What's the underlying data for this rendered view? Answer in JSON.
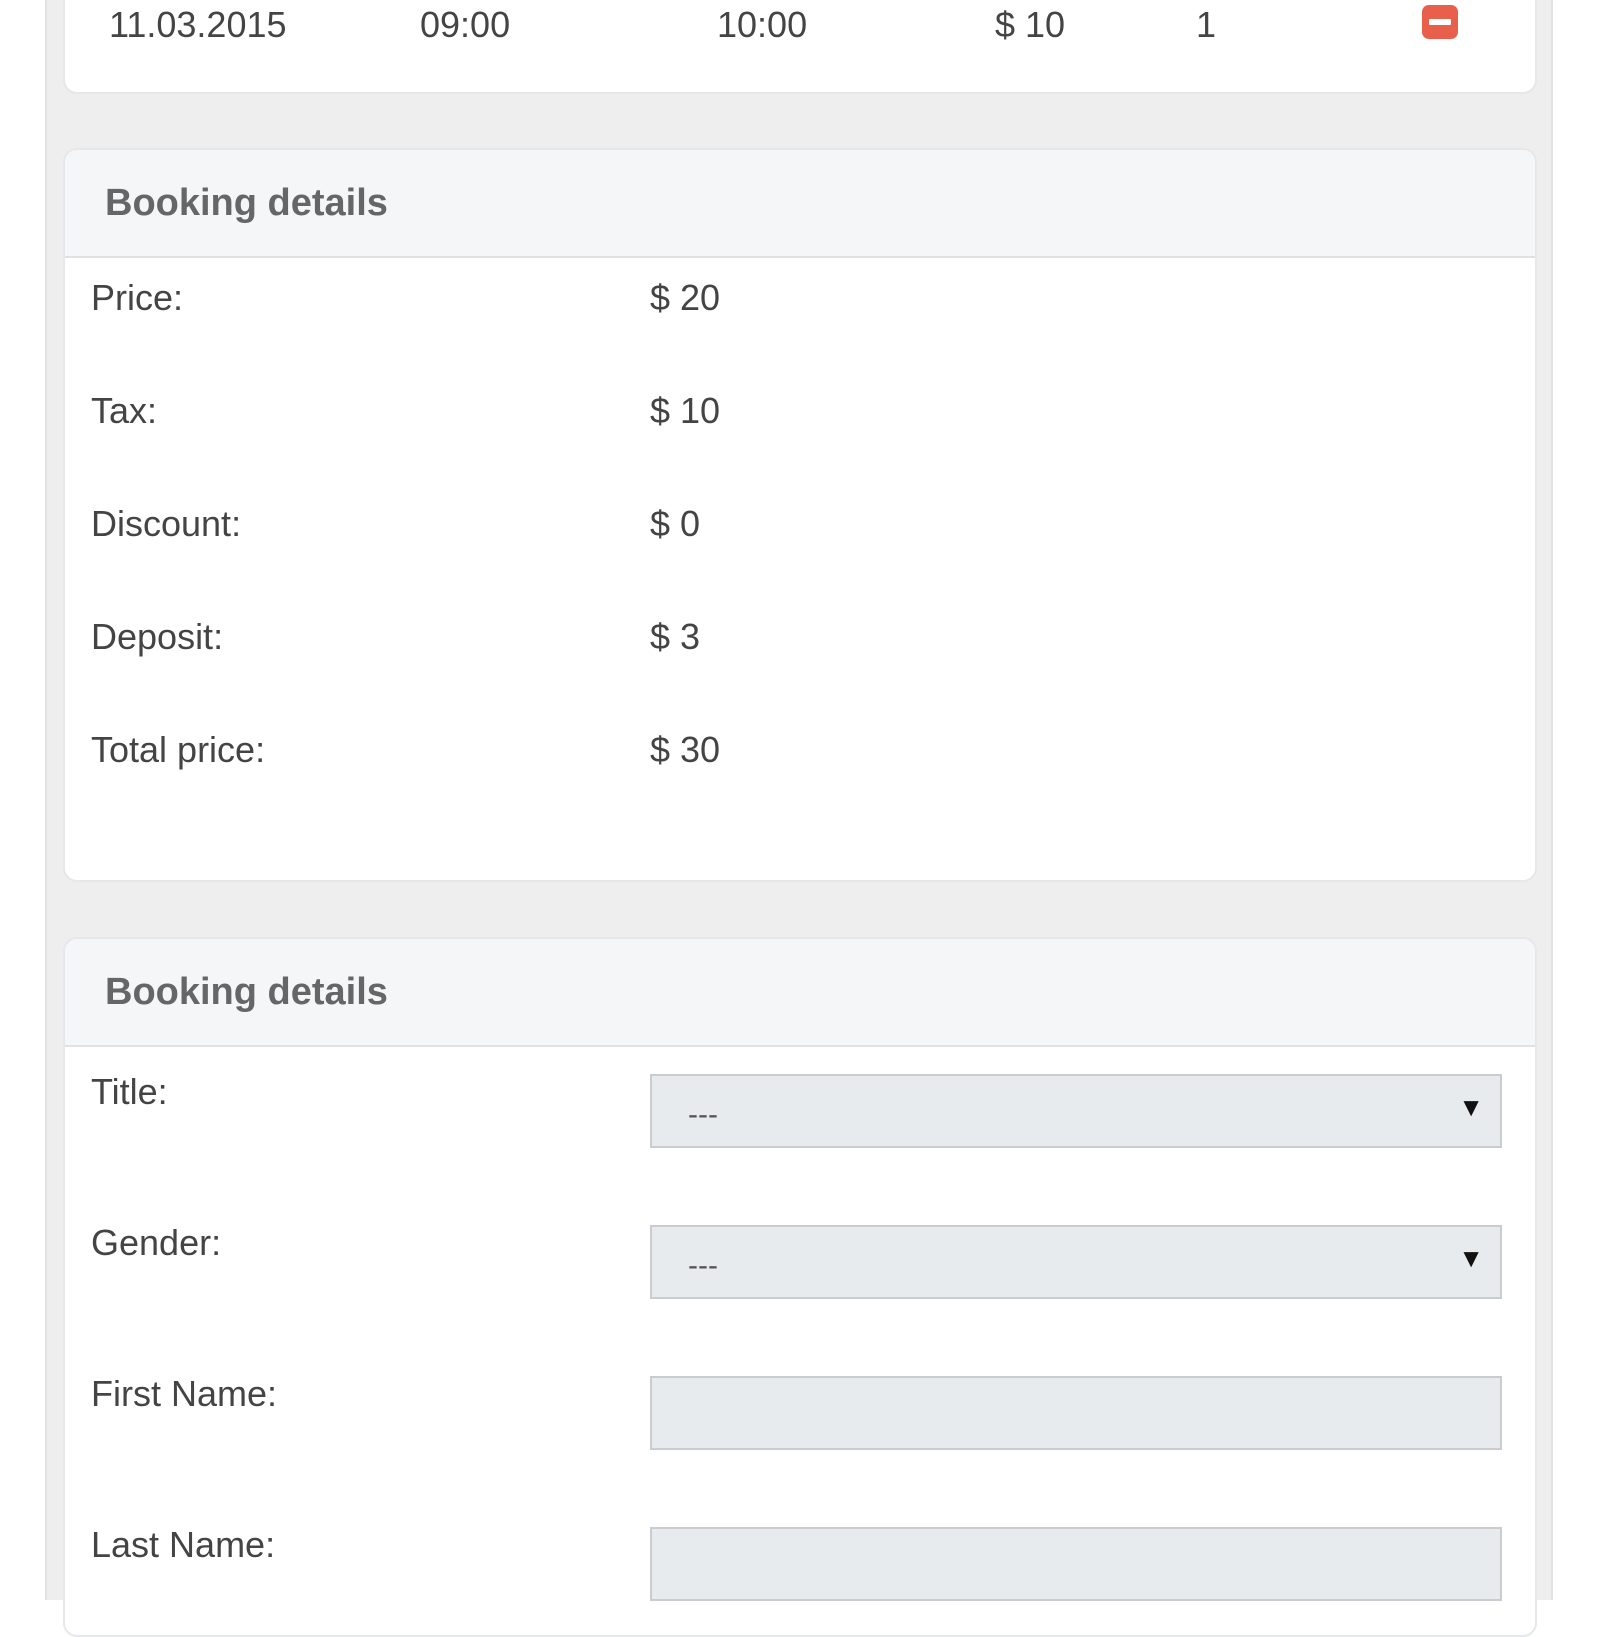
{
  "slot_row": {
    "date": "11.03.2015",
    "start_time": "09:00",
    "end_time": "10:00",
    "price": "$ 10",
    "quantity": "1"
  },
  "price_section": {
    "title": "Booking details",
    "rows": [
      {
        "label": "Price:",
        "value": "$ 20"
      },
      {
        "label": "Tax:",
        "value": "$ 10"
      },
      {
        "label": "Discount:",
        "value": "$ 0"
      },
      {
        "label": "Deposit:",
        "value": "$ 3"
      },
      {
        "label": "Total price:",
        "value": "$ 30"
      }
    ]
  },
  "form_section": {
    "title": "Booking details",
    "title_field": {
      "label": "Title:",
      "selected": "---"
    },
    "gender_field": {
      "label": "Gender:",
      "selected": "---"
    },
    "first_name_field": {
      "label": "First Name:",
      "value": ""
    },
    "last_name_field": {
      "label": "Last Name:",
      "value": ""
    }
  },
  "colors": {
    "remove_button": "#e8604c",
    "page_background": "#eeeeee",
    "card_header": "#f5f6f8",
    "input_background": "#e8ebee"
  },
  "icons": {
    "remove": "minus-square-icon",
    "dropdown": "triangle-down-icon"
  }
}
